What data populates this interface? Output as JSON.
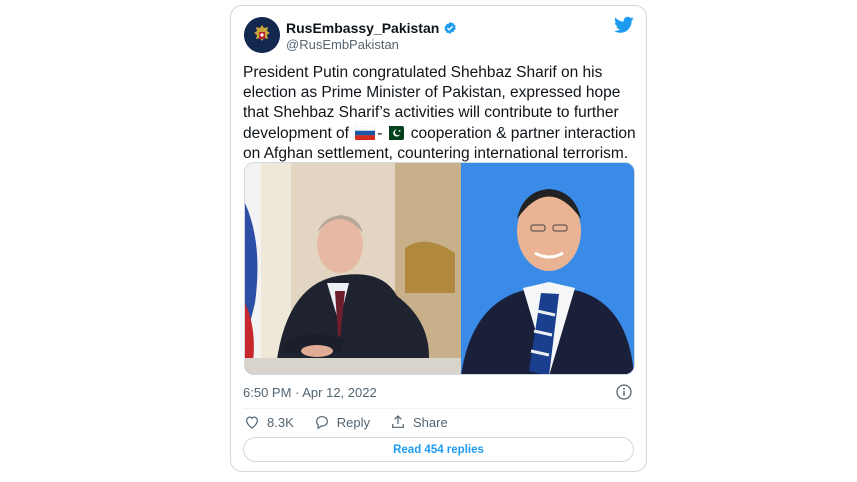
{
  "tweet": {
    "display_name": "RusEmbassy_Pakistan",
    "handle": "@RusEmbPakistan",
    "text_line1": "President Putin congratulated Shehbaz Sharif on his",
    "text_line2": "election as Prime Minister of Pakistan, expressed hope",
    "text_line3": "that Shehbaz Sharif’s activities will contribute to further",
    "text_line4a": "development of ",
    "text_line4b": "-",
    "text_line4c": " cooperation & partner interaction",
    "text_line5": "on Afghan settlement, countering international terrorism.",
    "timestamp": "6:50 PM · Apr 12, 2022",
    "likes": "8.3K",
    "reply_label": "Reply",
    "share_label": "Share",
    "read_replies_label": "Read 454 replies"
  },
  "icons": {
    "verified": "verified-badge-icon",
    "bird": "twitter-bird-icon",
    "info": "info-icon",
    "heart": "heart-icon",
    "reply": "reply-icon",
    "share": "share-icon",
    "flag_russia": "russia-flag-icon",
    "flag_pakistan": "pakistan-flag-icon"
  },
  "colors": {
    "accent": "#1d9bf0",
    "text": "#0f1419",
    "muted": "#536471",
    "border": "#cfd9de"
  }
}
